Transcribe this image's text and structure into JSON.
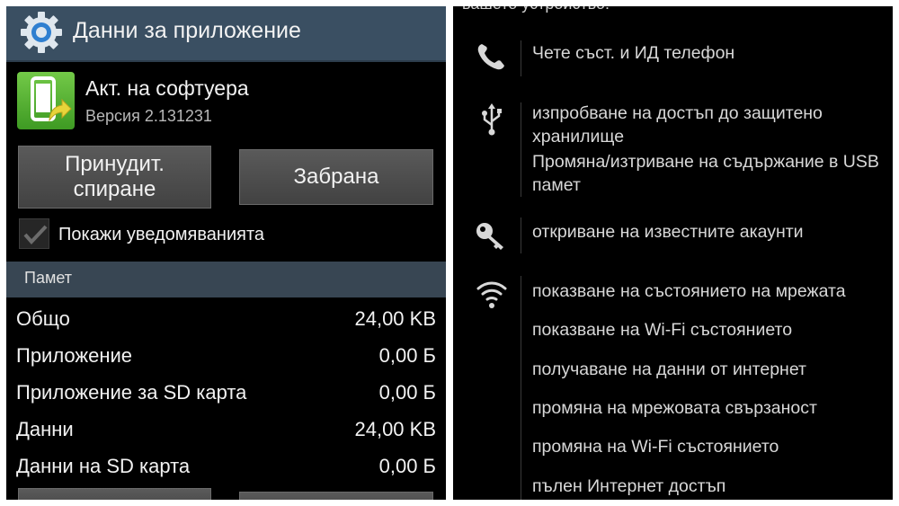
{
  "left_panel": {
    "header": {
      "title": "Данни за приложение",
      "icon": "gear-icon"
    },
    "app": {
      "name": "Акт. на софтуера",
      "version": "Версия 2.131231",
      "icon": "software-update-icon"
    },
    "buttons": {
      "force_stop": "Принудит. спиране",
      "disable": "Забрана"
    },
    "notifications": {
      "label": "Покажи уведомяванията",
      "checked": true
    },
    "memory": {
      "section_title": "Памет",
      "rows": [
        {
          "label": "Общо",
          "value": "24,00 KB"
        },
        {
          "label": "Приложение",
          "value": "0,00 Б"
        },
        {
          "label": "Приложение за SD карта",
          "value": "0,00 Б"
        },
        {
          "label": "Данни",
          "value": "24,00 KB"
        },
        {
          "label": "Данни на SD карта",
          "value": "0,00 Б"
        }
      ]
    },
    "accent_color": "#3a4f62"
  },
  "right_panel": {
    "top_cut_text": "вашето устройство:",
    "permission_groups": [
      {
        "icon": "phone-icon",
        "items": [
          "Чете съст. и ИД телефон"
        ]
      },
      {
        "icon": "usb-icon",
        "items": [
          "изпробване на достъп до защитено хранилище",
          "Промяна/изтриване на съдържание в USB памет"
        ]
      },
      {
        "icon": "key-icon",
        "items": [
          "откриване на известните акаунти"
        ]
      },
      {
        "icon": "wifi-icon",
        "items": [
          "показване на състоянието на мрежата",
          "показване на Wi-Fi състоянието",
          "получаване на данни от интернет",
          "промяна на мрежовата свързаност",
          "промяна на Wi-Fi състоянието",
          "пълен Интернет достъп"
        ]
      }
    ]
  }
}
